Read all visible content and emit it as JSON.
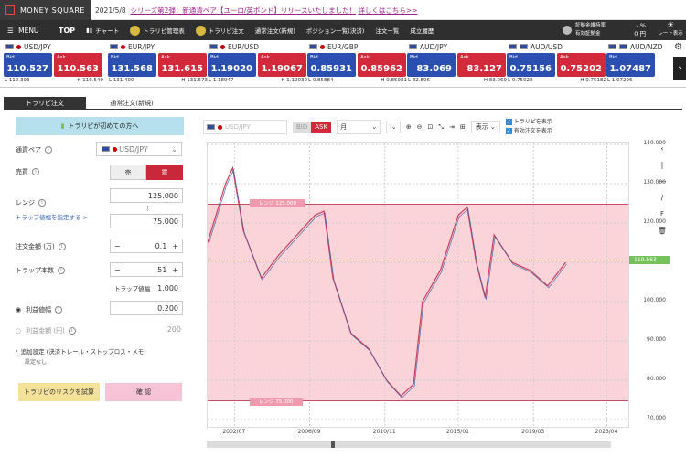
{
  "brand": {
    "name": "MONEY SQUARE"
  },
  "news": {
    "date": "2021/5/8",
    "text": "シリーズ第2弾：新通貨ペア【ユーロ/英ポンド】リリースいたしました！",
    "link": "詳しくはこちら>>"
  },
  "nav": {
    "menu": "MENU",
    "top": "TOP",
    "chart": "チャート",
    "trap_manage": "トラリピ管理表",
    "trap_order": "トラリピ注文",
    "normal_order": "通常注文(新規)",
    "position_list": "ポジション一覧(決済)",
    "order_list": "注文一覧",
    "history": "成立履歴",
    "margin_ratio_label": "証拠金維持率",
    "margin_ratio": "- %",
    "available_label": "有効証拠金",
    "available": "0 円",
    "rate_label": "レート表示"
  },
  "rates": [
    {
      "pair": "USD/JPY",
      "bid_label": "Bid",
      "ask_label": "Ask",
      "bid": "110.527",
      "ask": "110.563",
      "l": "110.393",
      "h": "110.549"
    },
    {
      "pair": "EUR/JPY",
      "bid_label": "Bid",
      "ask_label": "Ask",
      "bid": "131.568",
      "ask": "131.615",
      "l": "131.400",
      "h": "131.573"
    },
    {
      "pair": "EUR/USD",
      "bid_label": "Bid",
      "ask_label": "Ask",
      "bid": "1.19020",
      "ask": "1.19067",
      "l": "1.18947",
      "h": "1.19030"
    },
    {
      "pair": "EUR/GBP",
      "bid_label": "Bid",
      "ask_label": "Ask",
      "bid": "0.85931",
      "ask": "0.85962",
      "l": "0.85884",
      "h": "0.85981"
    },
    {
      "pair": "AUD/JPY",
      "bid_label": "Bid",
      "ask_label": "Ask",
      "bid": "83.069",
      "ask": "83.127",
      "l": "82.896",
      "h": "83.069"
    },
    {
      "pair": "AUD/USD",
      "bid_label": "Bid",
      "ask_label": "Ask",
      "bid": "0.75156",
      "ask": "0.75202",
      "l": "0.75028",
      "h": "0.75182"
    },
    {
      "pair": "AUD/NZD",
      "bid_label": "Bid",
      "ask_label": "Ask",
      "bid": "1.07487",
      "ask": "",
      "l": "1.07296",
      "h": ""
    }
  ],
  "tabs": {
    "trap": "トラリピ注文",
    "normal": "通常注文(新規)"
  },
  "form": {
    "beginner": "トラリピが初めての方へ",
    "pair_label": "通貨ペア",
    "pair_value": "USD/JPY",
    "side_label": "売買",
    "sell": "売",
    "buy": "買",
    "range_label": "レンジ",
    "range_high": "125.000",
    "range_low": "75.000",
    "range_link": "トラップ値幅を指定する >",
    "amount_label": "注文金額 (万)",
    "amount": "0.1",
    "trap_count_label": "トラップ本数",
    "trap_count": "51",
    "trap_width_label": "トラップ値幅",
    "trap_width": "1.000",
    "profit_width_label": "利益値幅",
    "profit_width": "0.200",
    "profit_amount_label": "利益金額 (円)",
    "profit_amount": "200",
    "advanced": "追加設定 (決済トレール・ストップロス・メモ)",
    "advanced_sub": "設定なし",
    "risk_btn": "トラリピのリスクを試算",
    "confirm_btn": "確 認"
  },
  "chart": {
    "pair": "USD/JPY",
    "bid": "BID",
    "ask": "ASK",
    "period": "月",
    "display": "表示",
    "show_trap": "トラリピを表示",
    "show_orders": "有効注文を表示",
    "range_upper": "レンジ 125.000",
    "range_lower": "レンジ 75.000",
    "current": "110.563"
  },
  "chart_data": {
    "type": "line",
    "y_ticks": [
      "140.000",
      "130.000",
      "120.000",
      "110.000",
      "100.000",
      "90.000",
      "80.000",
      "70.000"
    ],
    "x_ticks": [
      "2002/07",
      "2006/09",
      "2010/11",
      "2015/01",
      "2019/03",
      "2023/04"
    ],
    "ylim": [
      70,
      140
    ],
    "x": [
      2001,
      2002,
      2002.4,
      2003,
      2004,
      2005,
      2006,
      2007,
      2007.5,
      2008,
      2009,
      2010,
      2011,
      2011.8,
      2012.5,
      2013,
      2014,
      2015,
      2015.5,
      2016,
      2016.5,
      2017,
      2018,
      2019,
      2020,
      2021
    ],
    "values": [
      115,
      130,
      134,
      118,
      106,
      112,
      117,
      122,
      123,
      106,
      92,
      88,
      80,
      76,
      79,
      100,
      108,
      122,
      124,
      110,
      101,
      117,
      110,
      108,
      104,
      110
    ],
    "range": [
      75,
      125
    ]
  }
}
